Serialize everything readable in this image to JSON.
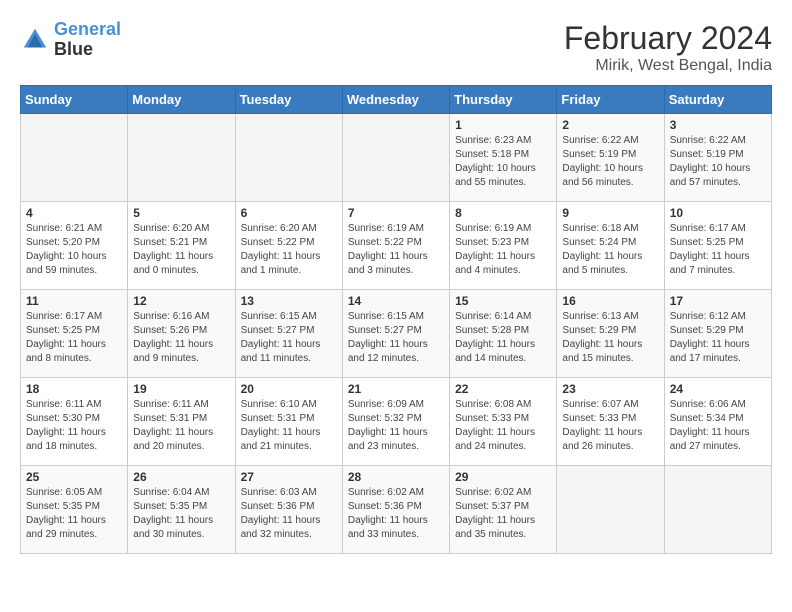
{
  "header": {
    "logo_line1": "General",
    "logo_line2": "Blue",
    "title": "February 2024",
    "subtitle": "Mirik, West Bengal, India"
  },
  "weekdays": [
    "Sunday",
    "Monday",
    "Tuesday",
    "Wednesday",
    "Thursday",
    "Friday",
    "Saturday"
  ],
  "weeks": [
    [
      {
        "day": "",
        "sunrise": "",
        "sunset": "",
        "daylight": ""
      },
      {
        "day": "",
        "sunrise": "",
        "sunset": "",
        "daylight": ""
      },
      {
        "day": "",
        "sunrise": "",
        "sunset": "",
        "daylight": ""
      },
      {
        "day": "",
        "sunrise": "",
        "sunset": "",
        "daylight": ""
      },
      {
        "day": "1",
        "sunrise": "Sunrise: 6:23 AM",
        "sunset": "Sunset: 5:18 PM",
        "daylight": "Daylight: 10 hours and 55 minutes."
      },
      {
        "day": "2",
        "sunrise": "Sunrise: 6:22 AM",
        "sunset": "Sunset: 5:19 PM",
        "daylight": "Daylight: 10 hours and 56 minutes."
      },
      {
        "day": "3",
        "sunrise": "Sunrise: 6:22 AM",
        "sunset": "Sunset: 5:19 PM",
        "daylight": "Daylight: 10 hours and 57 minutes."
      }
    ],
    [
      {
        "day": "4",
        "sunrise": "Sunrise: 6:21 AM",
        "sunset": "Sunset: 5:20 PM",
        "daylight": "Daylight: 10 hours and 59 minutes."
      },
      {
        "day": "5",
        "sunrise": "Sunrise: 6:20 AM",
        "sunset": "Sunset: 5:21 PM",
        "daylight": "Daylight: 11 hours and 0 minutes."
      },
      {
        "day": "6",
        "sunrise": "Sunrise: 6:20 AM",
        "sunset": "Sunset: 5:22 PM",
        "daylight": "Daylight: 11 hours and 1 minute."
      },
      {
        "day": "7",
        "sunrise": "Sunrise: 6:19 AM",
        "sunset": "Sunset: 5:22 PM",
        "daylight": "Daylight: 11 hours and 3 minutes."
      },
      {
        "day": "8",
        "sunrise": "Sunrise: 6:19 AM",
        "sunset": "Sunset: 5:23 PM",
        "daylight": "Daylight: 11 hours and 4 minutes."
      },
      {
        "day": "9",
        "sunrise": "Sunrise: 6:18 AM",
        "sunset": "Sunset: 5:24 PM",
        "daylight": "Daylight: 11 hours and 5 minutes."
      },
      {
        "day": "10",
        "sunrise": "Sunrise: 6:17 AM",
        "sunset": "Sunset: 5:25 PM",
        "daylight": "Daylight: 11 hours and 7 minutes."
      }
    ],
    [
      {
        "day": "11",
        "sunrise": "Sunrise: 6:17 AM",
        "sunset": "Sunset: 5:25 PM",
        "daylight": "Daylight: 11 hours and 8 minutes."
      },
      {
        "day": "12",
        "sunrise": "Sunrise: 6:16 AM",
        "sunset": "Sunset: 5:26 PM",
        "daylight": "Daylight: 11 hours and 9 minutes."
      },
      {
        "day": "13",
        "sunrise": "Sunrise: 6:15 AM",
        "sunset": "Sunset: 5:27 PM",
        "daylight": "Daylight: 11 hours and 11 minutes."
      },
      {
        "day": "14",
        "sunrise": "Sunrise: 6:15 AM",
        "sunset": "Sunset: 5:27 PM",
        "daylight": "Daylight: 11 hours and 12 minutes."
      },
      {
        "day": "15",
        "sunrise": "Sunrise: 6:14 AM",
        "sunset": "Sunset: 5:28 PM",
        "daylight": "Daylight: 11 hours and 14 minutes."
      },
      {
        "day": "16",
        "sunrise": "Sunrise: 6:13 AM",
        "sunset": "Sunset: 5:29 PM",
        "daylight": "Daylight: 11 hours and 15 minutes."
      },
      {
        "day": "17",
        "sunrise": "Sunrise: 6:12 AM",
        "sunset": "Sunset: 5:29 PM",
        "daylight": "Daylight: 11 hours and 17 minutes."
      }
    ],
    [
      {
        "day": "18",
        "sunrise": "Sunrise: 6:11 AM",
        "sunset": "Sunset: 5:30 PM",
        "daylight": "Daylight: 11 hours and 18 minutes."
      },
      {
        "day": "19",
        "sunrise": "Sunrise: 6:11 AM",
        "sunset": "Sunset: 5:31 PM",
        "daylight": "Daylight: 11 hours and 20 minutes."
      },
      {
        "day": "20",
        "sunrise": "Sunrise: 6:10 AM",
        "sunset": "Sunset: 5:31 PM",
        "daylight": "Daylight: 11 hours and 21 minutes."
      },
      {
        "day": "21",
        "sunrise": "Sunrise: 6:09 AM",
        "sunset": "Sunset: 5:32 PM",
        "daylight": "Daylight: 11 hours and 23 minutes."
      },
      {
        "day": "22",
        "sunrise": "Sunrise: 6:08 AM",
        "sunset": "Sunset: 5:33 PM",
        "daylight": "Daylight: 11 hours and 24 minutes."
      },
      {
        "day": "23",
        "sunrise": "Sunrise: 6:07 AM",
        "sunset": "Sunset: 5:33 PM",
        "daylight": "Daylight: 11 hours and 26 minutes."
      },
      {
        "day": "24",
        "sunrise": "Sunrise: 6:06 AM",
        "sunset": "Sunset: 5:34 PM",
        "daylight": "Daylight: 11 hours and 27 minutes."
      }
    ],
    [
      {
        "day": "25",
        "sunrise": "Sunrise: 6:05 AM",
        "sunset": "Sunset: 5:35 PM",
        "daylight": "Daylight: 11 hours and 29 minutes."
      },
      {
        "day": "26",
        "sunrise": "Sunrise: 6:04 AM",
        "sunset": "Sunset: 5:35 PM",
        "daylight": "Daylight: 11 hours and 30 minutes."
      },
      {
        "day": "27",
        "sunrise": "Sunrise: 6:03 AM",
        "sunset": "Sunset: 5:36 PM",
        "daylight": "Daylight: 11 hours and 32 minutes."
      },
      {
        "day": "28",
        "sunrise": "Sunrise: 6:02 AM",
        "sunset": "Sunset: 5:36 PM",
        "daylight": "Daylight: 11 hours and 33 minutes."
      },
      {
        "day": "29",
        "sunrise": "Sunrise: 6:02 AM",
        "sunset": "Sunset: 5:37 PM",
        "daylight": "Daylight: 11 hours and 35 minutes."
      },
      {
        "day": "",
        "sunrise": "",
        "sunset": "",
        "daylight": ""
      },
      {
        "day": "",
        "sunrise": "",
        "sunset": "",
        "daylight": ""
      }
    ]
  ]
}
